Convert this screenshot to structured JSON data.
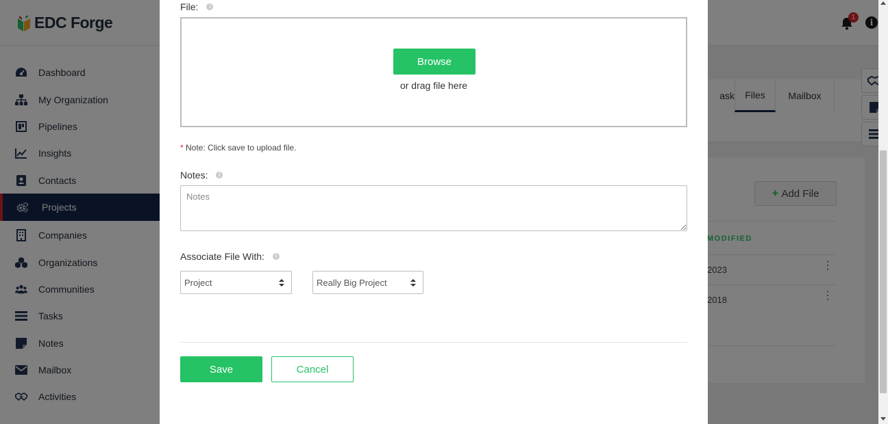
{
  "app": {
    "logo_text": "EDC Forge",
    "notification_count": "1",
    "info_glyph": "i"
  },
  "sidebar": {
    "items": [
      {
        "label": "Dashboard",
        "icon": "dashboard-icon"
      },
      {
        "label": "My Organization",
        "icon": "org-chart-icon"
      },
      {
        "label": "Pipelines",
        "icon": "pipelines-icon"
      },
      {
        "label": "Insights",
        "icon": "insights-chart-icon"
      },
      {
        "label": "Contacts",
        "icon": "contacts-icon"
      },
      {
        "label": "Projects",
        "icon": "gears-icon",
        "active": true
      },
      {
        "label": "Companies",
        "icon": "building-icon"
      },
      {
        "label": "Organizations",
        "icon": "organizations-icon"
      },
      {
        "label": "Communities",
        "icon": "communities-icon"
      },
      {
        "label": "Tasks",
        "icon": "tasks-icon"
      },
      {
        "label": "Notes",
        "icon": "note-icon"
      },
      {
        "label": "Mailbox",
        "icon": "envelope-icon"
      },
      {
        "label": "Activities",
        "icon": "handshake-icon"
      }
    ]
  },
  "background": {
    "tabs": [
      "ask",
      "Files",
      "Mailbox"
    ],
    "add_file_label": "Add File",
    "column_header": "MODIFIED",
    "rows": [
      "2023",
      "2018"
    ]
  },
  "modal": {
    "file_label": "File:",
    "browse_label": "Browse",
    "drag_text": "or drag file here",
    "note_required_mark": "*",
    "note_text": "Note: Click save to upload file.",
    "notes_label": "Notes:",
    "notes_placeholder": "Notes",
    "associate_label": "Associate File With:",
    "associate_type": "Project",
    "associate_target": "Really Big Project",
    "save_label": "Save",
    "cancel_label": "Cancel"
  },
  "colors": {
    "accent_green": "#26c266",
    "nav_active_bg": "#14264d",
    "alert_red": "#d9262c"
  }
}
